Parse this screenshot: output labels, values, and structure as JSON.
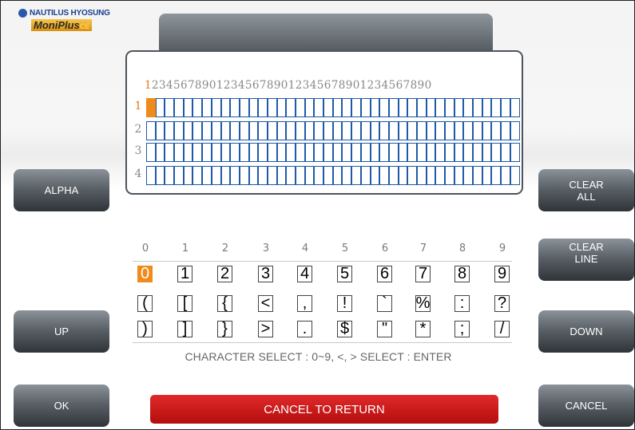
{
  "logo": {
    "brand": "NAUTILUS HYOSUNG",
    "product": "MoniPlus",
    "product_suffix": "CE"
  },
  "editor": {
    "column_digits_first": "1",
    "column_digits_rest": "234567890123456789012345678901234567890",
    "rows": [
      "1",
      "2",
      "3",
      "4"
    ],
    "cells_per_row": 40,
    "selected_row": 1,
    "selected_col": 1
  },
  "buttons": {
    "alpha": "ALPHA",
    "up": "UP",
    "ok": "OK",
    "clear_all": "CLEAR ALL",
    "clear_line": "CLEAR LINE",
    "down": "DOWN",
    "cancel": "CANCEL"
  },
  "char_select": {
    "headers": [
      "0",
      "1",
      "2",
      "3",
      "4",
      "5",
      "6",
      "7",
      "8",
      "9"
    ],
    "rows": [
      [
        "0",
        "1",
        "2",
        "3",
        "4",
        "5",
        "6",
        "7",
        "8",
        "9"
      ],
      [
        "(",
        "[",
        "{",
        "<",
        ",",
        "!",
        "`",
        "%",
        ":",
        "?"
      ],
      [
        ")",
        "]",
        "}",
        ">",
        ".",
        "$",
        "\"",
        "*",
        ";",
        "/"
      ]
    ],
    "selected": "0"
  },
  "hint": "CHARACTER SELECT : 0~9, <, >  SELECT : ENTER",
  "cancel_to_return": "CANCEL TO RETURN",
  "colors": {
    "accent": "#f08a1a",
    "cell_border": "#1f5aa8",
    "cancel_bar": "#c81414"
  }
}
